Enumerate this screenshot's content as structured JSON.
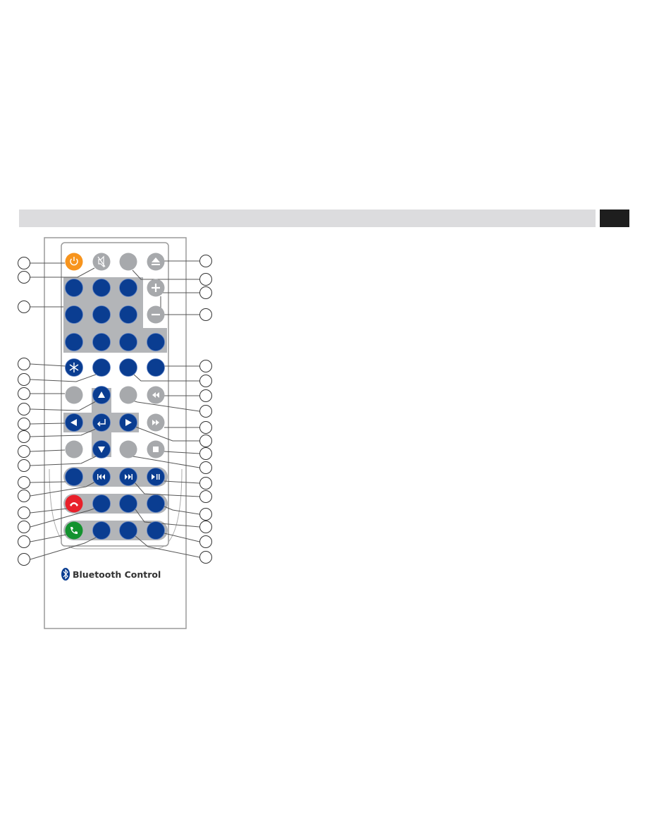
{
  "header": {
    "bar_color": "#dcdcde",
    "page_tab_color": "#1e1e1e"
  },
  "remote": {
    "logo_text": "Bluetooth Control",
    "colors": {
      "blue": "#0a3d91",
      "gray": "#a7a9ac",
      "orange": "#f7941d",
      "red": "#e8202a",
      "green": "#13922f",
      "panel": "#b3b5b8"
    },
    "buttons": [
      {
        "name": "power-button",
        "color": "orange",
        "icon": "power-icon"
      },
      {
        "name": "mute-button",
        "color": "gray",
        "icon": "mute-icon"
      },
      {
        "name": "gray-button-row1",
        "color": "gray",
        "icon": ""
      },
      {
        "name": "eject-button",
        "color": "gray",
        "icon": "eject-icon"
      },
      {
        "name": "number-button",
        "color": "blue",
        "icon": ""
      },
      {
        "name": "number-button",
        "color": "blue",
        "icon": ""
      },
      {
        "name": "number-button",
        "color": "blue",
        "icon": ""
      },
      {
        "name": "volume-up-button",
        "color": "gray",
        "icon": "plus-icon"
      },
      {
        "name": "number-button",
        "color": "blue",
        "icon": ""
      },
      {
        "name": "number-button",
        "color": "blue",
        "icon": ""
      },
      {
        "name": "number-button",
        "color": "blue",
        "icon": ""
      },
      {
        "name": "volume-down-button",
        "color": "gray",
        "icon": "minus-icon"
      },
      {
        "name": "number-button",
        "color": "blue",
        "icon": ""
      },
      {
        "name": "number-button",
        "color": "blue",
        "icon": ""
      },
      {
        "name": "number-button",
        "color": "blue",
        "icon": ""
      },
      {
        "name": "number-button",
        "color": "blue",
        "icon": ""
      },
      {
        "name": "asterisk-button",
        "color": "blue",
        "icon": "asterisk-icon"
      },
      {
        "name": "blue-button",
        "color": "blue",
        "icon": ""
      },
      {
        "name": "blue-button",
        "color": "blue",
        "icon": ""
      },
      {
        "name": "blue-button",
        "color": "blue",
        "icon": ""
      },
      {
        "name": "gray-button",
        "color": "gray",
        "icon": ""
      },
      {
        "name": "up-button",
        "color": "blue",
        "icon": "arrow-up-icon"
      },
      {
        "name": "gray-button",
        "color": "gray",
        "icon": ""
      },
      {
        "name": "rewind-button",
        "color": "gray",
        "icon": "rewind-icon"
      },
      {
        "name": "left-button",
        "color": "blue",
        "icon": "arrow-left-icon"
      },
      {
        "name": "enter-button",
        "color": "blue",
        "icon": "enter-icon"
      },
      {
        "name": "right-button",
        "color": "blue",
        "icon": "arrow-right-icon"
      },
      {
        "name": "fast-forward-button",
        "color": "gray",
        "icon": "fast-forward-icon"
      },
      {
        "name": "gray-button",
        "color": "gray",
        "icon": ""
      },
      {
        "name": "down-button",
        "color": "blue",
        "icon": "arrow-down-icon"
      },
      {
        "name": "gray-button",
        "color": "gray",
        "icon": ""
      },
      {
        "name": "stop-button",
        "color": "gray",
        "icon": "stop-icon"
      },
      {
        "name": "blue-button",
        "color": "blue",
        "icon": ""
      },
      {
        "name": "previous-track-button",
        "color": "blue",
        "icon": "previous-icon"
      },
      {
        "name": "next-track-button",
        "color": "blue",
        "icon": "next-icon"
      },
      {
        "name": "play-pause-button",
        "color": "blue",
        "icon": "play-pause-icon"
      },
      {
        "name": "hang-up-button",
        "color": "red",
        "icon": "phone-hangup-icon"
      },
      {
        "name": "blue-button",
        "color": "blue",
        "icon": ""
      },
      {
        "name": "blue-button",
        "color": "blue",
        "icon": ""
      },
      {
        "name": "blue-button",
        "color": "blue",
        "icon": ""
      },
      {
        "name": "call-button",
        "color": "green",
        "icon": "phone-call-icon"
      },
      {
        "name": "blue-button",
        "color": "blue",
        "icon": ""
      },
      {
        "name": "blue-button",
        "color": "blue",
        "icon": ""
      },
      {
        "name": "blue-button",
        "color": "blue",
        "icon": ""
      }
    ]
  }
}
